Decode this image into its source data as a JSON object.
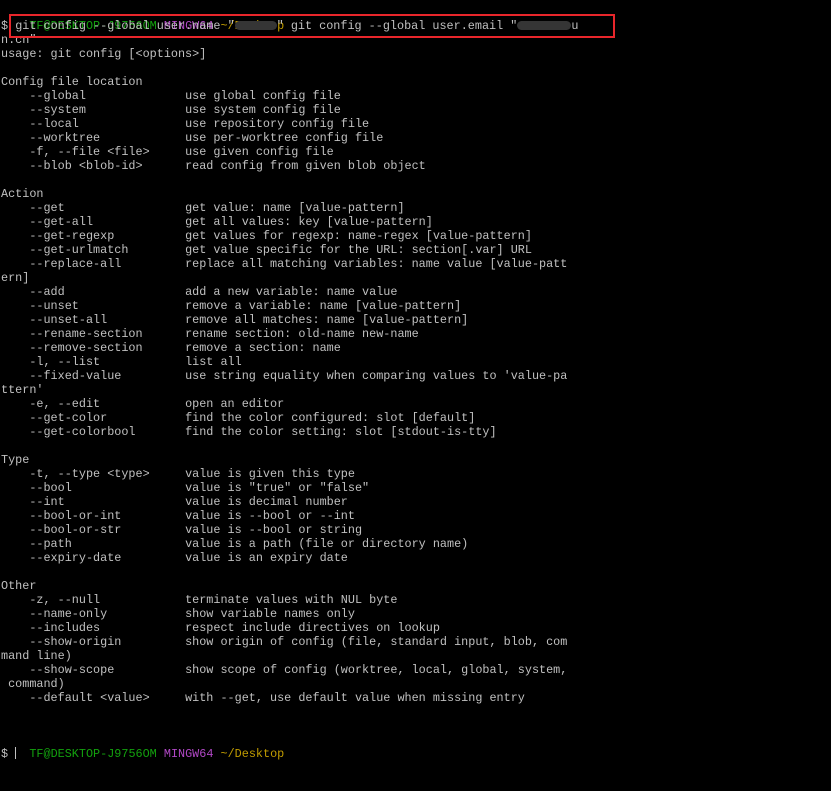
{
  "colors": {
    "background": "#000000",
    "text": "#c0c0c0",
    "user": "#13a10e",
    "host": "#b148c6",
    "path": "#c19c00",
    "highlight_box": "#e8262b"
  },
  "prompt": {
    "user": "TF@DESKTOP-J9756OM",
    "host": "MINGW64",
    "path": "~/Desktop"
  },
  "command": {
    "symbol": "$",
    "part1": "git config --global user.name \"",
    "part2": "\" git config --global user.email \"",
    "part3": "u",
    "wrap": "n.cn\""
  },
  "usage": "usage: git config [<options>]",
  "sections": [
    {
      "title": "Config file location",
      "options": [
        {
          "flag": "    --global              ",
          "desc": "use global config file"
        },
        {
          "flag": "    --system              ",
          "desc": "use system config file"
        },
        {
          "flag": "    --local               ",
          "desc": "use repository config file"
        },
        {
          "flag": "    --worktree            ",
          "desc": "use per-worktree config file"
        },
        {
          "flag": "    -f, --file <file>     ",
          "desc": "use given config file"
        },
        {
          "flag": "    --blob <blob-id>      ",
          "desc": "read config from given blob object"
        }
      ]
    },
    {
      "title": "Action",
      "options": [
        {
          "flag": "    --get                 ",
          "desc": "get value: name [value-pattern]"
        },
        {
          "flag": "    --get-all             ",
          "desc": "get all values: key [value-pattern]"
        },
        {
          "flag": "    --get-regexp          ",
          "desc": "get values for regexp: name-regex [value-pattern]"
        },
        {
          "flag": "    --get-urlmatch        ",
          "desc": "get value specific for the URL: section[.var] URL"
        },
        {
          "flag": "    --replace-all         ",
          "desc": "replace all matching variables: name value [value-patt",
          "cont": "ern]"
        },
        {
          "flag": "    --add                 ",
          "desc": "add a new variable: name value"
        },
        {
          "flag": "    --unset               ",
          "desc": "remove a variable: name [value-pattern]"
        },
        {
          "flag": "    --unset-all           ",
          "desc": "remove all matches: name [value-pattern]"
        },
        {
          "flag": "    --rename-section      ",
          "desc": "rename section: old-name new-name"
        },
        {
          "flag": "    --remove-section      ",
          "desc": "remove a section: name"
        },
        {
          "flag": "    -l, --list            ",
          "desc": "list all"
        },
        {
          "flag": "    --fixed-value         ",
          "desc": "use string equality when comparing values to 'value-pa",
          "cont": "ttern'"
        },
        {
          "flag": "    -e, --edit            ",
          "desc": "open an editor"
        },
        {
          "flag": "    --get-color           ",
          "desc": "find the color configured: slot [default]"
        },
        {
          "flag": "    --get-colorbool       ",
          "desc": "find the color setting: slot [stdout-is-tty]"
        }
      ]
    },
    {
      "title": "Type",
      "options": [
        {
          "flag": "    -t, --type <type>     ",
          "desc": "value is given this type"
        },
        {
          "flag": "    --bool                ",
          "desc": "value is \"true\" or \"false\""
        },
        {
          "flag": "    --int                 ",
          "desc": "value is decimal number"
        },
        {
          "flag": "    --bool-or-int         ",
          "desc": "value is --bool or --int"
        },
        {
          "flag": "    --bool-or-str         ",
          "desc": "value is --bool or string"
        },
        {
          "flag": "    --path                ",
          "desc": "value is a path (file or directory name)"
        },
        {
          "flag": "    --expiry-date         ",
          "desc": "value is an expiry date"
        }
      ]
    },
    {
      "title": "Other",
      "options": [
        {
          "flag": "    -z, --null            ",
          "desc": "terminate values with NUL byte"
        },
        {
          "flag": "    --name-only           ",
          "desc": "show variable names only"
        },
        {
          "flag": "    --includes            ",
          "desc": "respect include directives on lookup"
        },
        {
          "flag": "    --show-origin         ",
          "desc": "show origin of config (file, standard input, blob, com",
          "cont": "mand line)"
        },
        {
          "flag": "    --show-scope          ",
          "desc": "show scope of config (worktree, local, global, system,",
          "cont": " command)"
        },
        {
          "flag": "    --default <value>     ",
          "desc": "with --get, use default value when missing entry"
        }
      ]
    }
  ],
  "final_prompt": {
    "user": "TF@DESKTOP-J9756OM",
    "host": "MINGW64",
    "path": "~/Desktop",
    "symbol": "$ "
  }
}
